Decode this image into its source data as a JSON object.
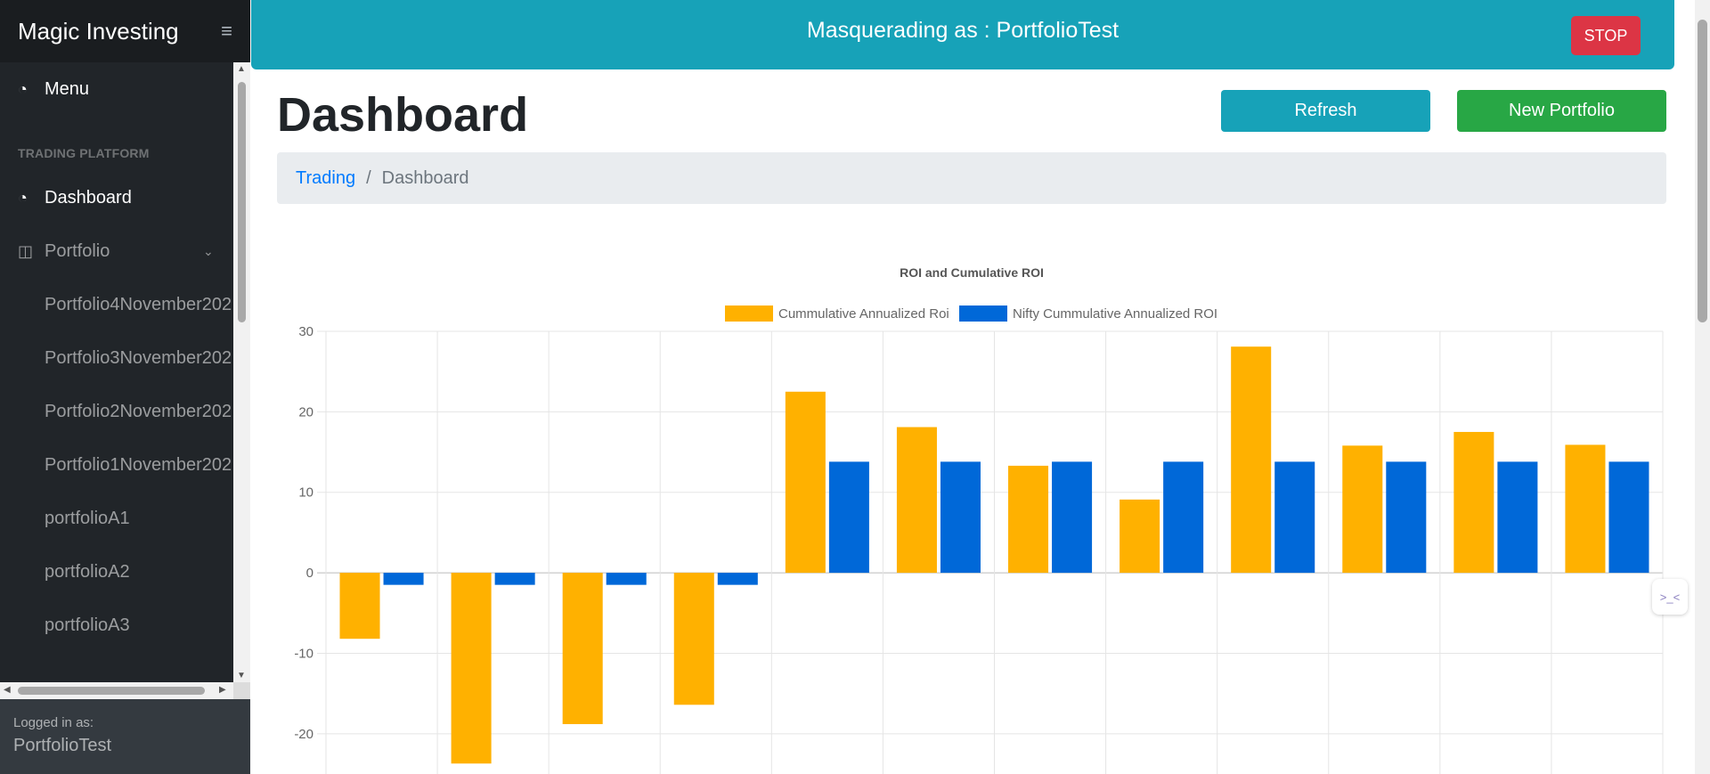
{
  "sidebar": {
    "brand": "Magic Investing",
    "menu_label": "Menu",
    "section_heading": "TRADING PLATFORM",
    "dashboard_label": "Dashboard",
    "portfolio_label": "Portfolio",
    "portfolio_items": [
      "Portfolio4November202",
      "Portfolio3November202",
      "Portfolio2November202",
      "Portfolio1November202",
      "portfolioA1",
      "portfolioA2",
      "portfolioA3"
    ],
    "logged_in_label": "Logged in as:",
    "logged_in_user": "PortfolioTest"
  },
  "banner": {
    "text": "Masquerading as : PortfolioTest",
    "stop_label": "STOP"
  },
  "header": {
    "title": "Dashboard",
    "refresh_label": "Refresh",
    "new_portfolio_label": "New Portfolio"
  },
  "breadcrumb": {
    "link": "Trading",
    "separator": "/",
    "current": "Dashboard"
  },
  "colors": {
    "series1": "#ffb100",
    "series2": "#0068d8",
    "banner": "#17a2b8",
    "stop": "#dc3545",
    "refresh": "#17a2b8",
    "new_portfolio": "#28a745"
  },
  "chart_data": {
    "type": "bar",
    "title": "ROI and Cumulative ROI",
    "xlabel": "",
    "ylabel": "",
    "ylim": [
      -25,
      30
    ],
    "yticks": [
      30,
      20,
      10,
      0,
      -10,
      -20
    ],
    "grid": true,
    "legend_position": "top",
    "categories": [
      "",
      "",
      "",
      "",
      "",
      "",
      "",
      "",
      "",
      "",
      "",
      ""
    ],
    "series": [
      {
        "name": "Cummulative Annualized Roi",
        "color": "#ffb100",
        "values": [
          -8.2,
          -23.7,
          -18.8,
          -16.4,
          22.5,
          18.1,
          13.3,
          9.1,
          28.1,
          15.8,
          17.5,
          15.9
        ]
      },
      {
        "name": "Nifty Cummulative Annualized ROI",
        "color": "#0068d8",
        "values": [
          -1.5,
          -1.5,
          -1.5,
          -1.5,
          13.8,
          13.8,
          13.8,
          13.8,
          13.8,
          13.8,
          13.8,
          13.8
        ]
      }
    ]
  }
}
